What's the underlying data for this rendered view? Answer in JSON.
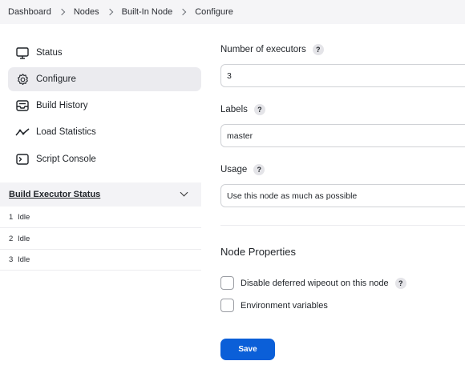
{
  "breadcrumb": [
    "Dashboard",
    "Nodes",
    "Built-In Node",
    "Configure"
  ],
  "sidebar": {
    "items": [
      {
        "label": "Status",
        "icon": "monitor-icon"
      },
      {
        "label": "Configure",
        "icon": "gear-icon",
        "active": true
      },
      {
        "label": "Build History",
        "icon": "inbox-icon"
      },
      {
        "label": "Load Statistics",
        "icon": "trend-icon"
      },
      {
        "label": "Script Console",
        "icon": "terminal-icon"
      }
    ]
  },
  "executors": {
    "title": "Build Executor Status",
    "rows": [
      {
        "num": "1",
        "status": "Idle"
      },
      {
        "num": "2",
        "status": "Idle"
      },
      {
        "num": "3",
        "status": "Idle"
      }
    ]
  },
  "form": {
    "executors_label": "Number of executors",
    "executors_value": "3",
    "labels_label": "Labels",
    "labels_value": "master",
    "usage_label": "Usage",
    "usage_value": "Use this node as much as possible",
    "help": "?",
    "node_properties": "Node Properties",
    "checkboxes": [
      {
        "label": "Disable deferred wipeout on this node",
        "help": true
      },
      {
        "label": "Environment variables",
        "help": false
      }
    ],
    "save_label": "Save"
  },
  "colors": {
    "accent": "#0b5fd8",
    "active_bg": "#ebebef",
    "breadcrumb_bg": "#f5f5f7"
  }
}
